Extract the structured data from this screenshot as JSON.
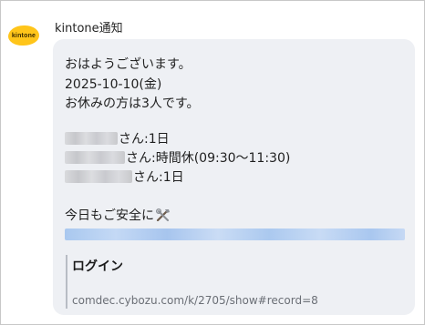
{
  "sender": {
    "name": "kintone通知",
    "avatar_text": "kintone"
  },
  "message": {
    "greeting": "おはようございます。",
    "date": "2025-10-10(金)",
    "summary": "お休みの方は3人です。",
    "absences": [
      {
        "detail": "さん:1日"
      },
      {
        "detail": "さん:時間休(09:30～11:30)"
      },
      {
        "detail": "さん:1日"
      }
    ],
    "closing": "今日もご安全に",
    "closing_icon": "tools-icon"
  },
  "preview": {
    "title": "ログイン",
    "url": "comdec.cybozu.com/k/2705/show#record=8"
  },
  "colors": {
    "bubble": "#eef0f4",
    "avatar_brand": "#ffc51a",
    "link": "#a9c8ef"
  }
}
